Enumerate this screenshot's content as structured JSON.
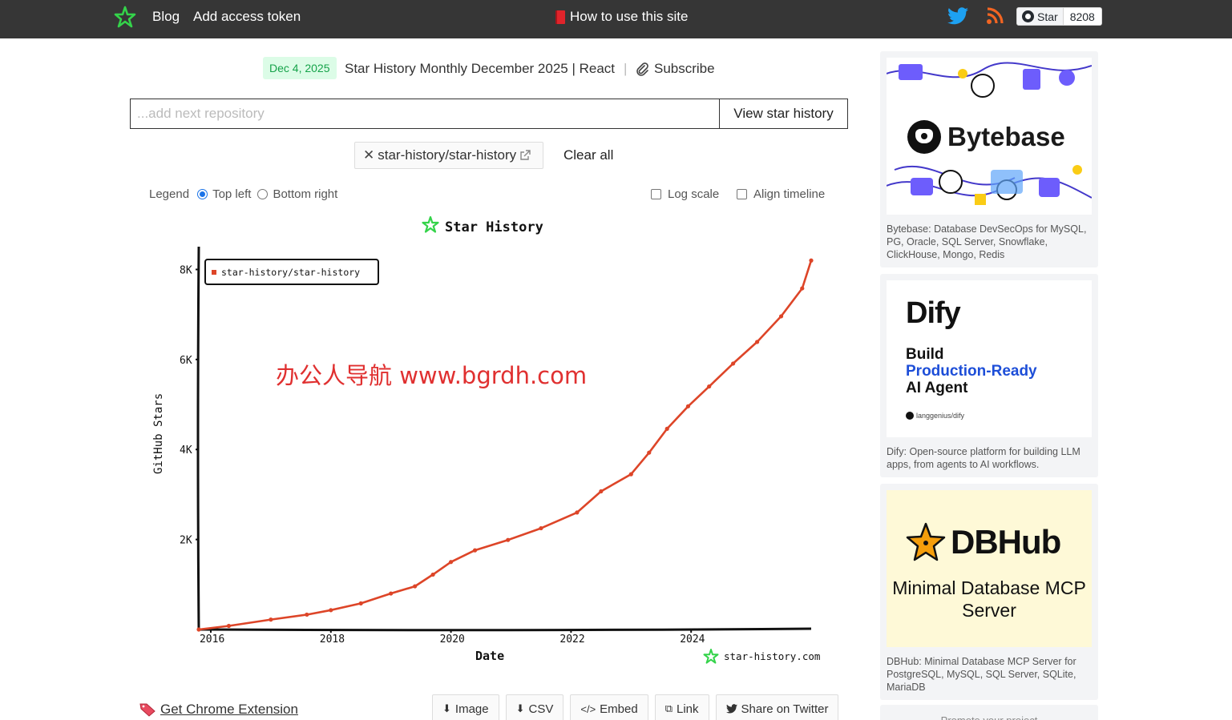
{
  "nav": {
    "blog": "Blog",
    "add_token": "Add access token",
    "how_to": "How to use this site",
    "github_star_label": "Star",
    "github_star_count": "8208"
  },
  "announcement": {
    "date": "Dec 4, 2025",
    "text": "Star History Monthly December 2025 | React",
    "separator": "|",
    "subscribe": "Subscribe"
  },
  "search": {
    "placeholder": "...add next repository",
    "value": "",
    "button": "View star history"
  },
  "repos": {
    "chip": "star-history/star-history",
    "remove_glyph": "✕",
    "clear_all": "Clear all"
  },
  "options": {
    "legend_label": "Legend",
    "legend_top_left": "Top left",
    "legend_bottom_right": "Bottom right",
    "legend_selected": "Top left",
    "log_scale": "Log scale",
    "log_scale_checked": false,
    "align_timeline": "Align timeline",
    "align_timeline_checked": false
  },
  "chart_data": {
    "type": "line",
    "title": "Star History",
    "xlabel": "Date",
    "ylabel": "GitHub Stars",
    "x_ticks": [
      "2016",
      "2018",
      "2020",
      "2022",
      "2024"
    ],
    "y_ticks": [
      "2K",
      "4K",
      "6K",
      "8K"
    ],
    "xlim": [
      2015.8,
      2026.0
    ],
    "ylim": [
      0,
      8400
    ],
    "legend_position": "top-left",
    "watermark": "star-history.com",
    "color": "#dd4528",
    "series": [
      {
        "name": "star-history/star-history",
        "points": [
          [
            2015.8,
            0
          ],
          [
            2016.3,
            80
          ],
          [
            2017.0,
            220
          ],
          [
            2017.6,
            330
          ],
          [
            2018.0,
            430
          ],
          [
            2018.5,
            580
          ],
          [
            2019.0,
            800
          ],
          [
            2019.4,
            960
          ],
          [
            2019.7,
            1220
          ],
          [
            2020.0,
            1500
          ],
          [
            2020.4,
            1760
          ],
          [
            2020.95,
            1990
          ],
          [
            2021.5,
            2250
          ],
          [
            2022.1,
            2600
          ],
          [
            2022.5,
            3070
          ],
          [
            2023.0,
            3450
          ],
          [
            2023.3,
            3930
          ],
          [
            2023.6,
            4460
          ],
          [
            2023.95,
            4960
          ],
          [
            2024.3,
            5400
          ],
          [
            2024.7,
            5910
          ],
          [
            2025.1,
            6390
          ],
          [
            2025.5,
            6960
          ],
          [
            2025.85,
            7580
          ],
          [
            2026.0,
            8200
          ]
        ]
      }
    ]
  },
  "watermark_overlay": "办公人导航  www.bgrdh.com",
  "bottom": {
    "chrome_extension": "Get Chrome Extension",
    "buttons": [
      "Image",
      "CSV",
      "Embed",
      "Link",
      "Share on Twitter"
    ]
  },
  "sidebar": {
    "ads": [
      {
        "brand": "Bytebase",
        "caption": "Bytebase: Database DevSecOps for MySQL, PG, Oracle, SQL Server, Snowflake, ClickHouse, Mongo, Redis"
      },
      {
        "brand": "Dify",
        "headline_1": "Build",
        "headline_2": "Production-Ready",
        "headline_3": "AI Agent",
        "repo": "langgenius/dify",
        "caption": "Dify: Open-source platform for building LLM apps, from agents to AI workflows."
      },
      {
        "brand": "DBHub",
        "headline": "Minimal Database MCP Server",
        "caption": "DBHub: Minimal Database MCP Server for PostgreSQL, MySQL, SQL Server, SQLite, MariaDB"
      }
    ],
    "promo": "Promote your project"
  }
}
